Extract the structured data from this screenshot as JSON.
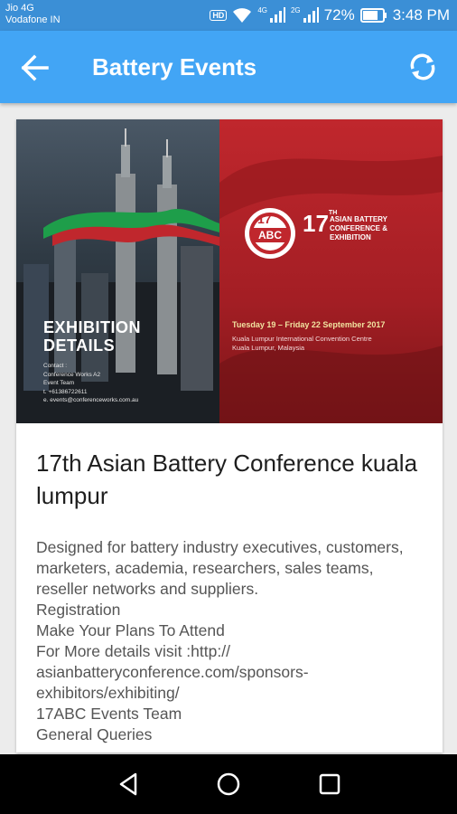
{
  "status_bar": {
    "carrier_1": "Jio 4G",
    "carrier_2": "Vodafone IN",
    "hd_badge": "HD",
    "net_1": "4G",
    "net_2": "2G",
    "battery": "72%",
    "time": "3:48 PM",
    "icons": [
      "wifi-icon",
      "signal-icon",
      "battery-icon"
    ]
  },
  "app_bar": {
    "title": "Battery Events",
    "back_icon": "arrow-back-icon",
    "refresh_icon": "refresh-icon"
  },
  "event": {
    "banner": {
      "exhibition_title_1": "EXHIBITION",
      "exhibition_title_2": "DETAILS",
      "contact": "Contact :\nConference Works A2\nEvent Team\nt. +61386722611\ne. events@conferenceworks.com.au",
      "logo_number": "17",
      "logo_text": "ABC",
      "conf_number": "17",
      "conf_sup": "TH",
      "conf_name": "ASIAN BATTERY\nCONFERENCE & EXHIBITION",
      "date": "Tuesday 19 – Friday 22 September 2017",
      "venue": "Kuala Lumpur International Convention Centre\nKuala Lumpur, Malaysia"
    },
    "title": "17th Asian Battery Conference kuala lumpur",
    "description": "Designed for battery industry executives, customers, marketers, academia, researchers, sales teams, reseller networks and suppliers.\nRegistration\nMake Your Plans To Attend\nFor More details visit :http://\nasianbatteryconference.com/sponsors-\nexhibitors/exhibiting/\n17ABC Events Team\nGeneral Queries"
  },
  "nav_bar": {
    "back": "nav-back-icon",
    "home": "nav-home-icon",
    "recents": "nav-recents-icon"
  },
  "colors": {
    "status_bar": "#3b8fd6",
    "app_bar": "#42a5f5",
    "banner_red": "#c0272d"
  }
}
